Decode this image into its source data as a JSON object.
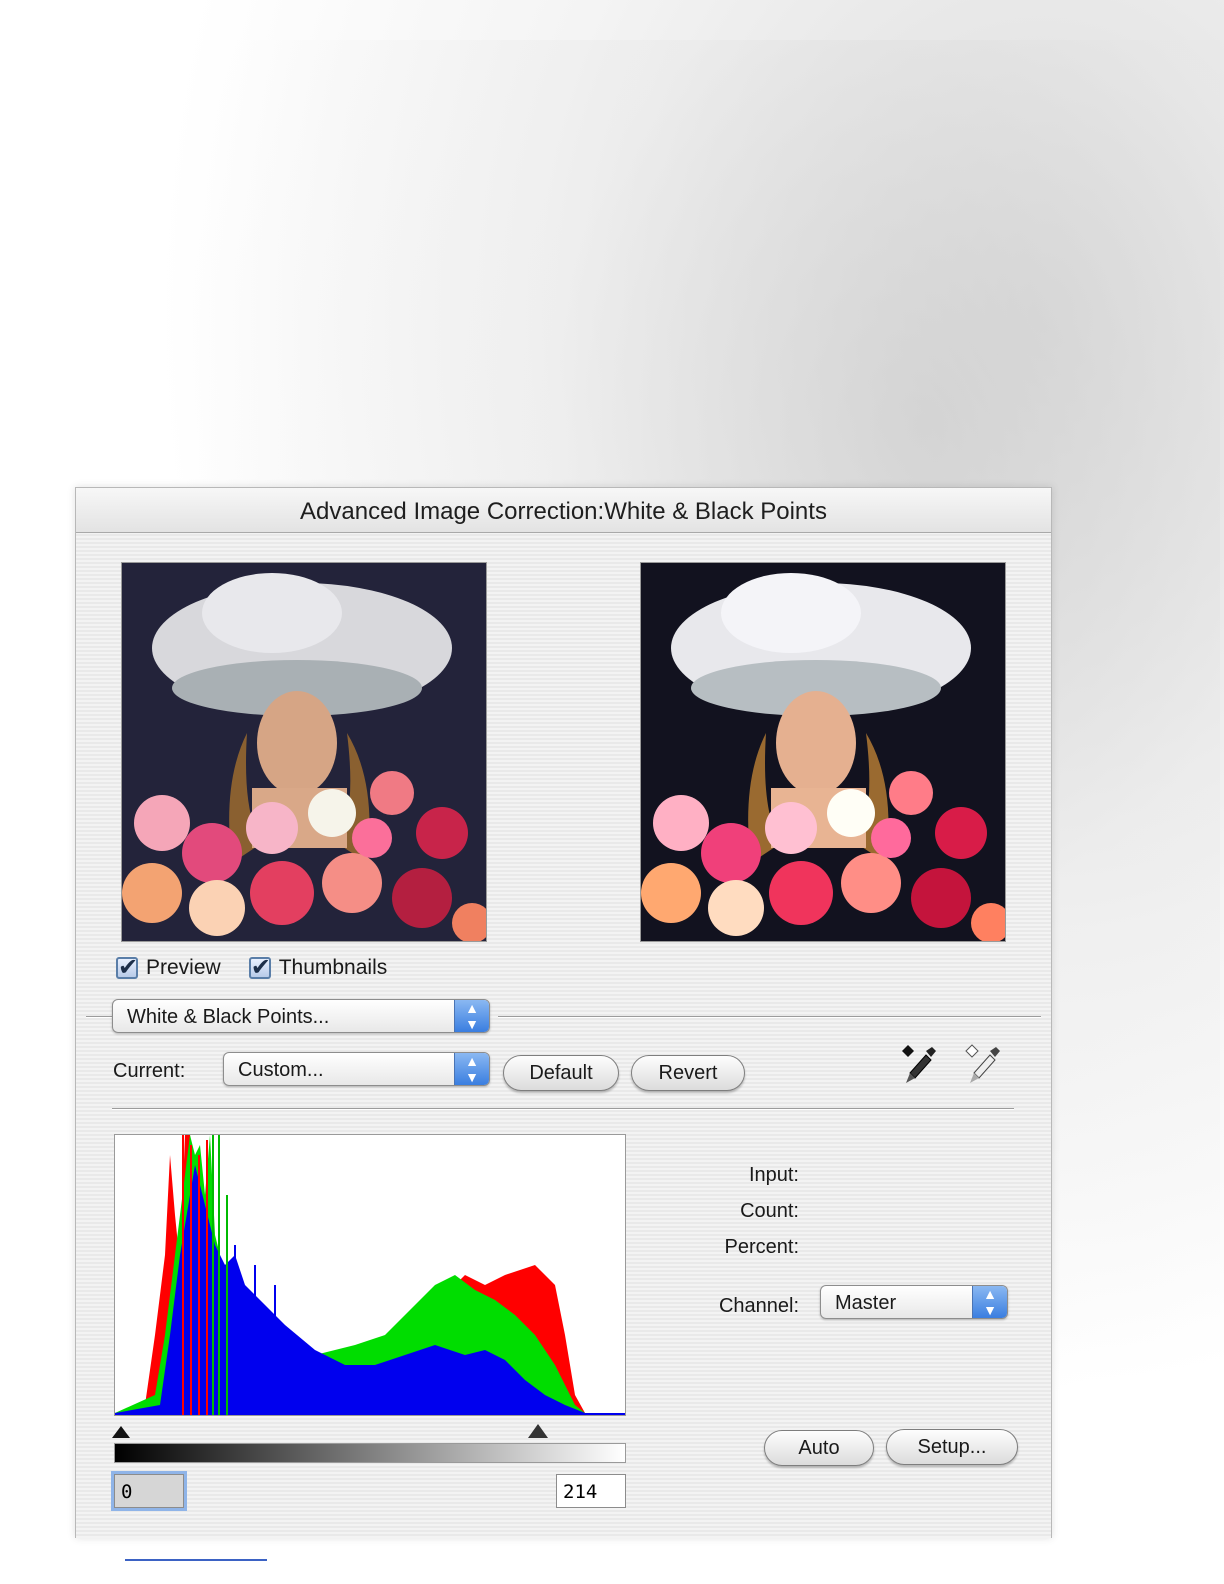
{
  "window": {
    "title": "Advanced Image Correction:White & Black Points"
  },
  "preview": {
    "before_label": "",
    "after_label": ""
  },
  "options": {
    "preview_label": "Preview",
    "thumbnails_label": "Thumbnails",
    "preview_checked": true,
    "thumbnails_checked": true
  },
  "tool_popup": {
    "value": "White & Black Points..."
  },
  "current": {
    "label": "Current:",
    "value": "Custom...",
    "default_button": "Default",
    "revert_button": "Revert"
  },
  "eyedroppers": [
    {
      "icon": "black-eyedropper-icon"
    },
    {
      "icon": "white-eyedropper-icon"
    }
  ],
  "info": {
    "input_label": "Input:",
    "count_label": "Count:",
    "percent_label": "Percent:"
  },
  "channel": {
    "label": "Channel:",
    "value": "Master"
  },
  "levels": {
    "black_point": "0",
    "white_point": "214"
  },
  "buttons": {
    "auto": "Auto",
    "setup": "Setup..."
  },
  "colors": {
    "red": "#ff0000",
    "green": "#00e000",
    "blue": "#0000ee",
    "accent": "#3a7ee0"
  }
}
